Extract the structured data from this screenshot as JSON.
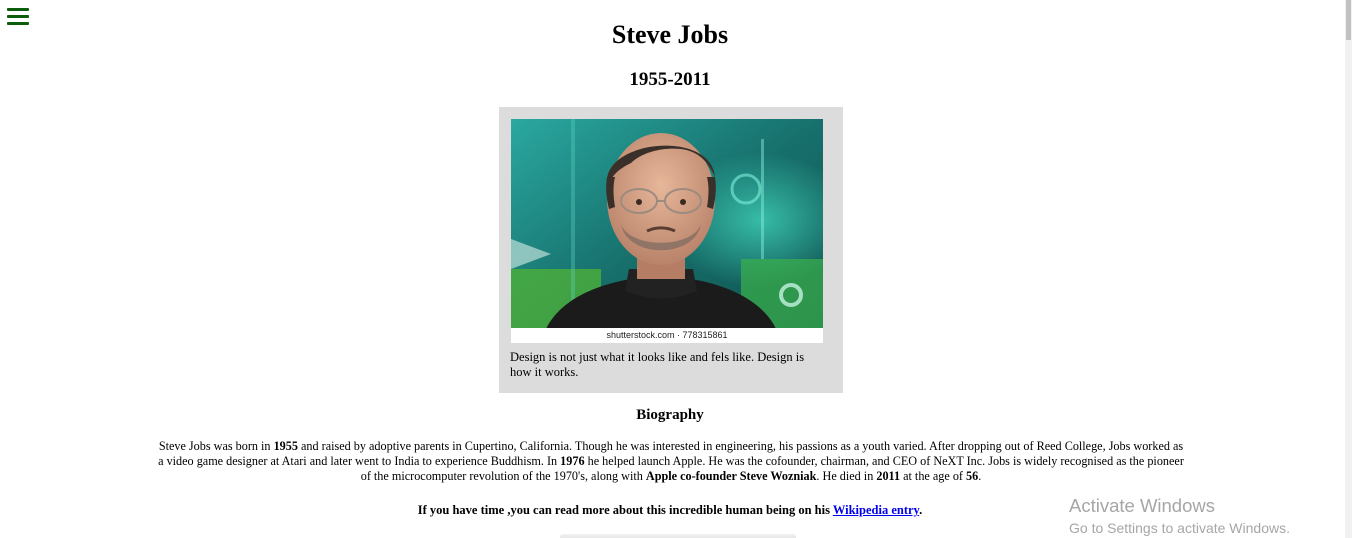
{
  "header": {
    "menu_icon": "hamburger-menu-icon",
    "title": "Steve Jobs",
    "dates": "1955-2011"
  },
  "figure": {
    "image_alt": "Portrait of Steve Jobs",
    "image_credit": "shutterstock.com · 778315861",
    "caption": "Design is not just what it looks like and fels like. Design is how it works."
  },
  "biography": {
    "heading": "Biography",
    "segments": [
      {
        "text": "Steve Jobs was born in ",
        "bold": false
      },
      {
        "text": "1955",
        "bold": true
      },
      {
        "text": " and raised by adoptive parents in Cupertino, California. Though he was interested in engineering, his passions as a youth varied. After dropping out of Reed College, Jobs worked as a video game designer at Atari and later went to India to experience Buddhism. In ",
        "bold": false
      },
      {
        "text": "1976",
        "bold": true
      },
      {
        "text": " he helped launch Apple. He was the cofounder, chairman, and CEO of NeXT Inc. Jobs is widely recognised as the pioneer of the microcomputer revolution of the 1970's, along with ",
        "bold": false
      },
      {
        "text": "Apple co-founder Steve Wozniak",
        "bold": true
      },
      {
        "text": ". He died in ",
        "bold": false
      },
      {
        "text": "2011",
        "bold": true
      },
      {
        "text": " at the age of ",
        "bold": false
      },
      {
        "text": "56",
        "bold": true
      },
      {
        "text": ".",
        "bold": false
      }
    ]
  },
  "more": {
    "prefix": "If you have time ,you can read more about this incredible human being on his ",
    "link_label": "Wikipedia entry",
    "suffix": "."
  },
  "os_watermark": {
    "line1": "Activate Windows",
    "line2": "Go to Settings to activate Windows."
  },
  "colors": {
    "menu_icon": "#0b5d0b",
    "card_background": "#dcdcdc",
    "link": "#0000ee",
    "watermark": "#a6a6a6"
  }
}
